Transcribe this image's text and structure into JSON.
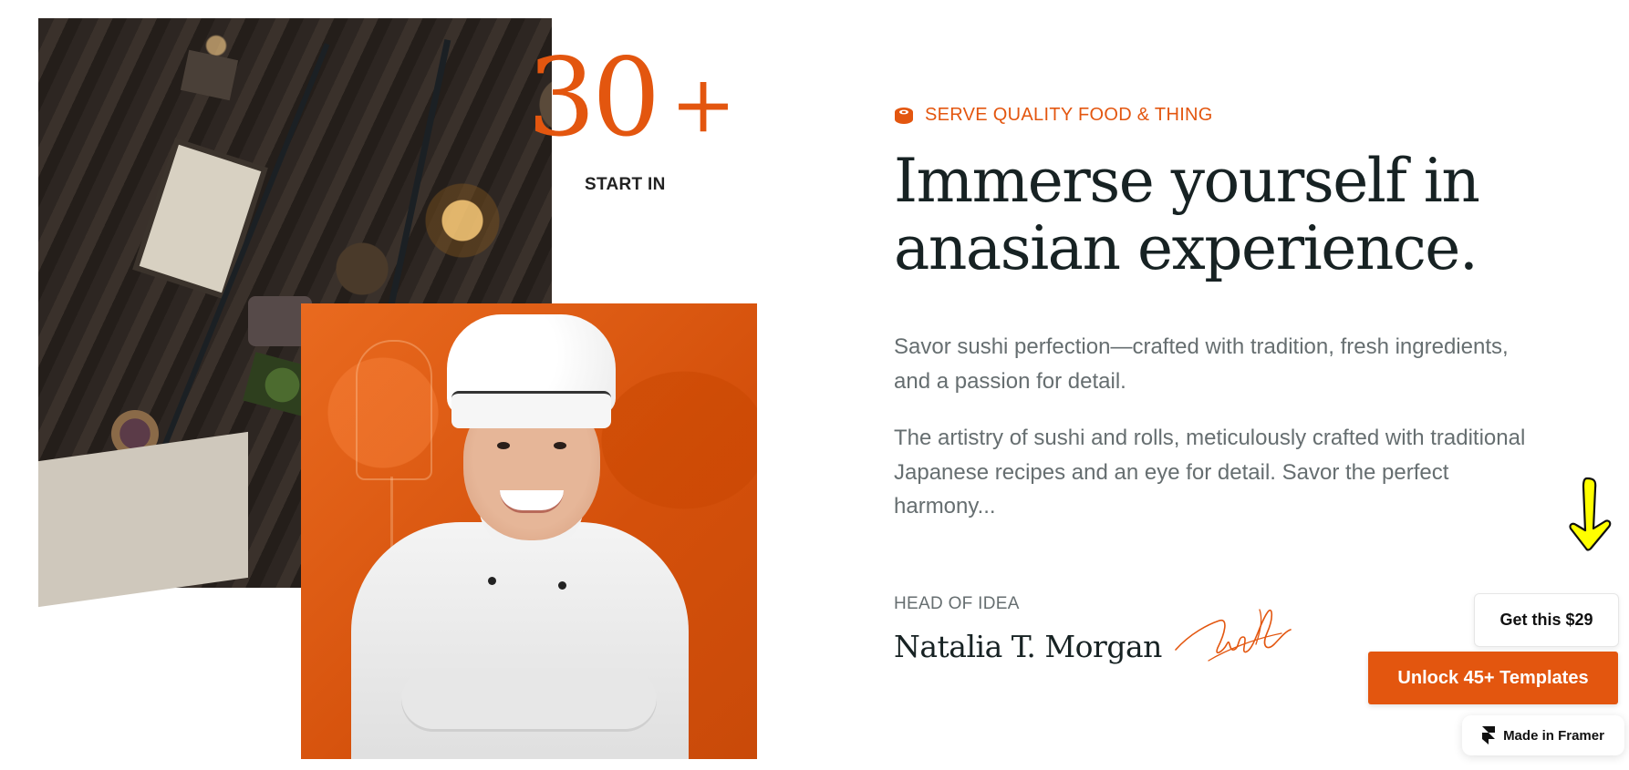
{
  "hero_stat": {
    "number": "30",
    "suffix": "+",
    "label": "START IN"
  },
  "section": {
    "eyebrow": "SERVE QUALITY FOOD & THING",
    "headline_line1": "Immerse yourself in",
    "headline_line2": "anasian experience.",
    "paragraph1": "Savor sushi perfection—crafted with tradition, fresh ingredients, and a passion for detail.",
    "paragraph2": "The artistry of sushi and rolls, meticulously crafted with traditional Japanese recipes and an eye for detail. Savor the perfect harmony..."
  },
  "author": {
    "role": "HEAD OF IDEA",
    "name": "Natalia T. Morgan"
  },
  "framer_widgets": {
    "get_label": "Get this $29",
    "unlock_label": "Unlock 45+ Templates",
    "made_in_label": "Made in Framer"
  },
  "icons": {
    "eyebrow": "sushi-roll-icon",
    "arrow": "down-arrow-icon",
    "framer": "framer-logo-icon"
  },
  "colors": {
    "accent": "#e3560f",
    "heading": "#172223",
    "body_text": "#666e70",
    "arrow": "#ffff00"
  }
}
